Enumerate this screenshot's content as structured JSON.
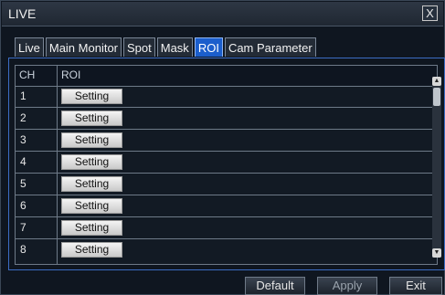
{
  "window": {
    "title": "LIVE",
    "close_glyph": "X"
  },
  "tabs": [
    {
      "label": "Live"
    },
    {
      "label": "Main Monitor"
    },
    {
      "label": "Spot"
    },
    {
      "label": "Mask"
    },
    {
      "label": "ROI",
      "active": true
    },
    {
      "label": "Cam Parameter"
    }
  ],
  "table": {
    "headers": {
      "ch": "CH",
      "roi": "ROI"
    },
    "rows": [
      {
        "ch": "1",
        "button": "Setting"
      },
      {
        "ch": "2",
        "button": "Setting"
      },
      {
        "ch": "3",
        "button": "Setting"
      },
      {
        "ch": "4",
        "button": "Setting"
      },
      {
        "ch": "5",
        "button": "Setting"
      },
      {
        "ch": "6",
        "button": "Setting"
      },
      {
        "ch": "7",
        "button": "Setting"
      },
      {
        "ch": "8",
        "button": "Setting"
      }
    ]
  },
  "footer": {
    "default_label": "Default",
    "apply_label": "Apply",
    "exit_label": "Exit"
  },
  "colors": {
    "active_tab": "#1b5ecc",
    "panel_border": "#3c6cc4",
    "background": "#0f1620"
  }
}
